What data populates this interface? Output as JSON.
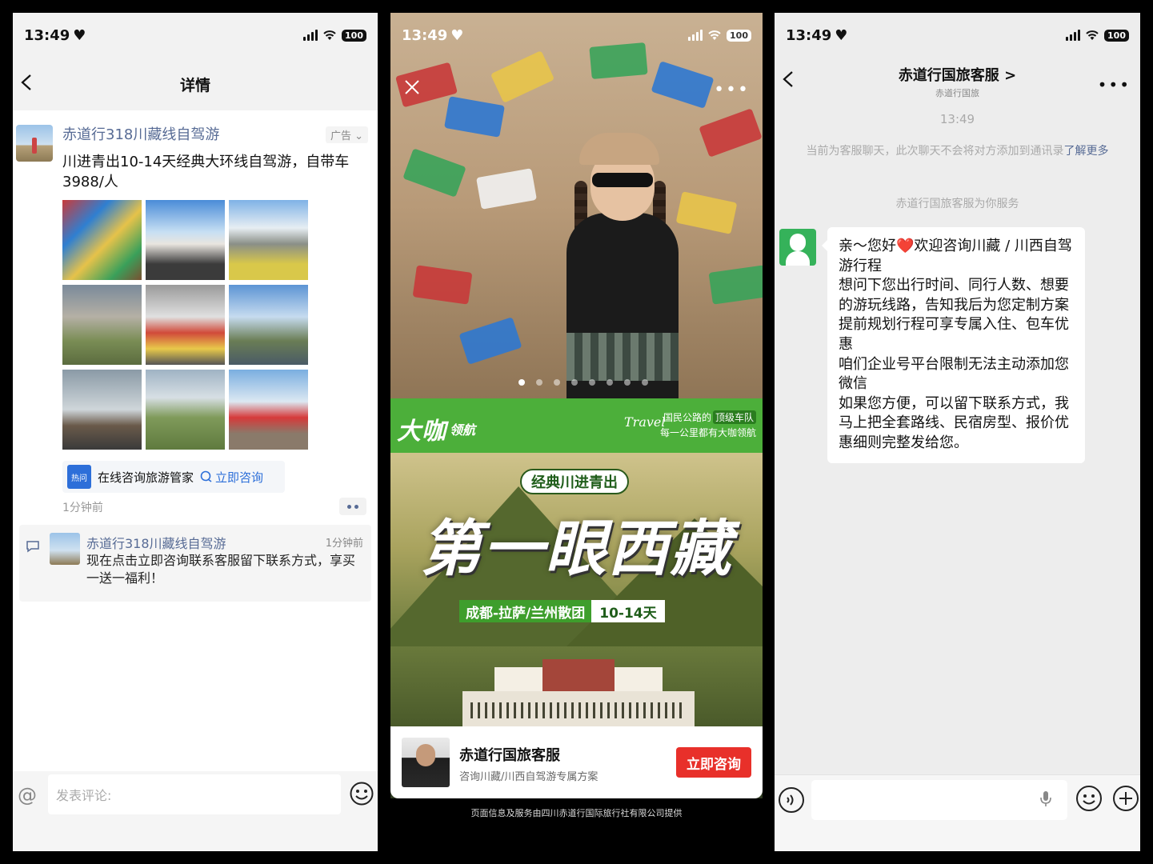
{
  "status_bar": {
    "time": "13:49",
    "battery": "100"
  },
  "left": {
    "nav_title": "详情",
    "ad": {
      "name": "赤道行318川藏线自驾游",
      "tag": "广告",
      "text": "川进青出10-14天经典大环线自驾游，自带车3988/人",
      "hot_badge": "热问",
      "consult_text": "在线咨询旅游管家",
      "consult_link": "立即咨询",
      "time": "1分钟前"
    },
    "comment": {
      "name": "赤道行318川藏线自驾游",
      "time": "1分钟前",
      "text": "现在点击立即咨询联系客服留下联系方式，享买一送一福利！"
    },
    "input_placeholder": "发表评论:"
  },
  "middle": {
    "brand": "大咖",
    "brand_sub": "领航",
    "banner_travel": "Travel",
    "banner_line1_prefix": "国民公路的",
    "banner_line1_tag": "顶级车队",
    "banner_line2": "每一公里都有大咖领航",
    "pill_top": "经典川进青出",
    "headline": "第一眼西藏",
    "route": "成都-拉萨/兰州散团",
    "days": "10-14天",
    "card_name": "赤道行国旅客服",
    "card_desc": "咨询川藏/川西自驾游专属方案",
    "card_button": "立即咨询",
    "footer": "页面信息及服务由四川赤道行国际旅行社有限公司提供"
  },
  "right": {
    "nav_title": "赤道行国旅客服 >",
    "nav_subtitle": "赤道行国旅",
    "chat_time": "13:49",
    "sys_note": "当前为客服聊天，此次聊天不会将对方添加到通讯录",
    "sys_link": "了解更多",
    "serve_note": "赤道行国旅客服为你服务",
    "message": "亲～您好❤️欢迎咨询川藏 / 川西自驾游行程\n想问下您出行时间、同行人数、想要的游玩线路，告知我后为您定制方案 提前规划行程可享专属入住、包车优惠\n咱们企业号平台限制无法主动添加您微信\n如果您方便，可以留下联系方式，我马上把全套路线、民宿房型、报价优惠细则完整发给您。"
  }
}
